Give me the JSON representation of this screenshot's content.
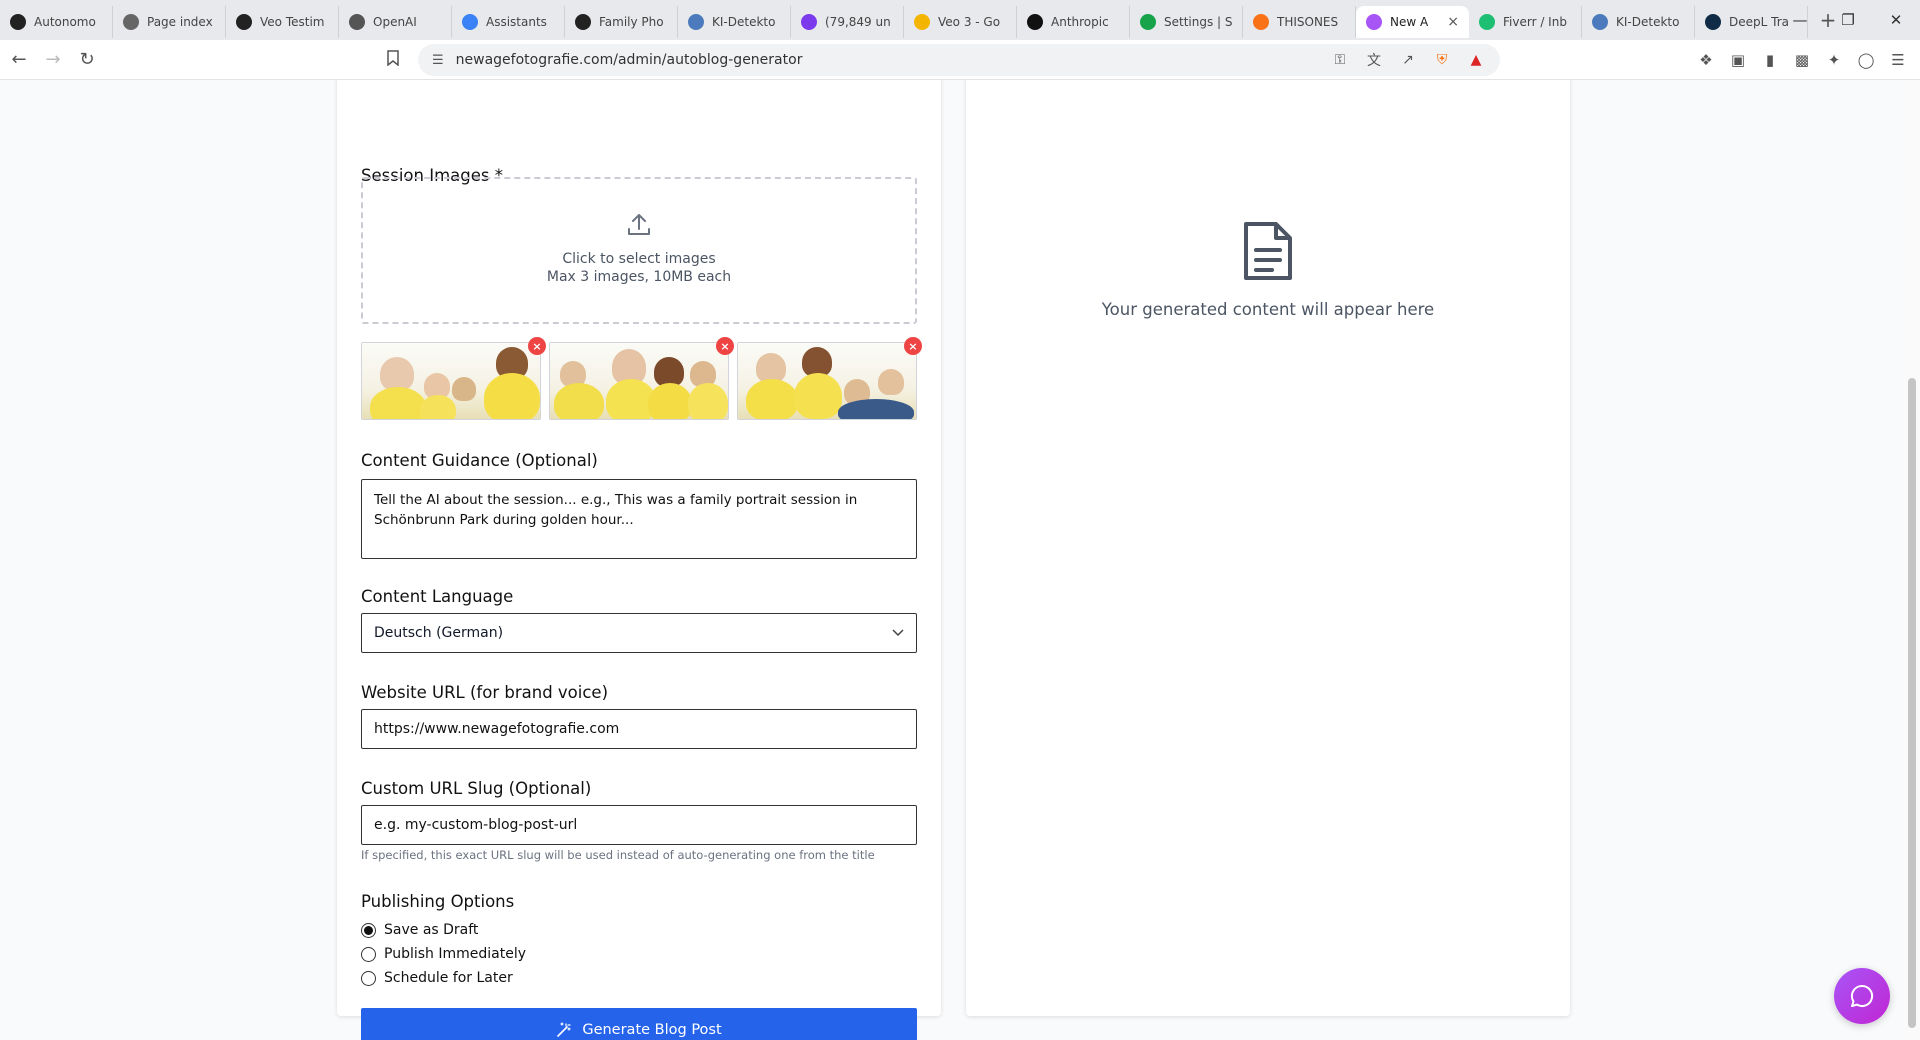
{
  "browser": {
    "tabs": [
      {
        "label": "Autonomo",
        "icon": "openai-icon",
        "color": "#222222"
      },
      {
        "label": "Page index",
        "icon": "page-index-icon",
        "color": "#666666"
      },
      {
        "label": "Veo Testim",
        "icon": "openai-icon",
        "color": "#222222"
      },
      {
        "label": "OpenAI",
        "icon": "openai-icon",
        "color": "#555555"
      },
      {
        "label": "Assistants",
        "icon": "assistants-icon",
        "color": "#3b82f6"
      },
      {
        "label": "Family Pho",
        "icon": "openai-icon",
        "color": "#222222"
      },
      {
        "label": "KI-Detekto",
        "icon": "ki-detektor-icon",
        "color": "#4b7bbd"
      },
      {
        "label": "(79,849 un",
        "icon": "mail-icon",
        "color": "#7c3aed"
      },
      {
        "label": "Veo 3 - Go",
        "icon": "drive-icon",
        "color": "#f4b400"
      },
      {
        "label": "Anthropic",
        "icon": "anthropic-icon",
        "color": "#111111"
      },
      {
        "label": "Settings | S",
        "icon": "settings-site-icon",
        "color": "#16a34a"
      },
      {
        "label": "THISONES",
        "icon": "thisones-icon",
        "color": "#f97316"
      },
      {
        "label": "New A",
        "icon": "new-a-icon",
        "color": "#a855f7"
      },
      {
        "label": "Fiverr / Inb",
        "icon": "fiverr-icon",
        "color": "#1dbf73"
      },
      {
        "label": "KI-Detekto",
        "icon": "ki-detektor-icon",
        "color": "#4b7bbd"
      },
      {
        "label": "DeepL Tra",
        "icon": "deepl-icon",
        "color": "#0f2b46"
      }
    ],
    "active_tab_index": 12,
    "url": "newagefotografie.com/admin/autoblog-generator"
  },
  "form": {
    "session_images_label": "Session Images *",
    "dropzone_line1": "Click to select images",
    "dropzone_line2": "Max 3 images, 10MB each",
    "thumbnail_count": 3,
    "content_guidance_label": "Content Guidance (Optional)",
    "content_guidance_placeholder": "Tell the AI about the session... e.g., This was a family portrait session in Schönbrunn Park during golden hour...",
    "content_language_label": "Content Language",
    "content_language_value": "Deutsch (German)",
    "website_url_label": "Website URL (for brand voice)",
    "website_url_value": "https://www.newagefotografie.com",
    "custom_slug_label": "Custom URL Slug (Optional)",
    "custom_slug_placeholder": "e.g. my-custom-blog-post-url",
    "custom_slug_hint": "If specified, this exact URL slug will be used instead of auto-generating one from the title",
    "publishing_label": "Publishing Options",
    "publishing_options": [
      {
        "label": "Save as Draft",
        "selected": true
      },
      {
        "label": "Publish Immediately",
        "selected": false
      },
      {
        "label": "Schedule for Later",
        "selected": false
      }
    ],
    "generate_button": "Generate Blog Post",
    "accent_color": "#2563eb"
  },
  "preview": {
    "placeholder_text": "Your generated content will appear here"
  }
}
